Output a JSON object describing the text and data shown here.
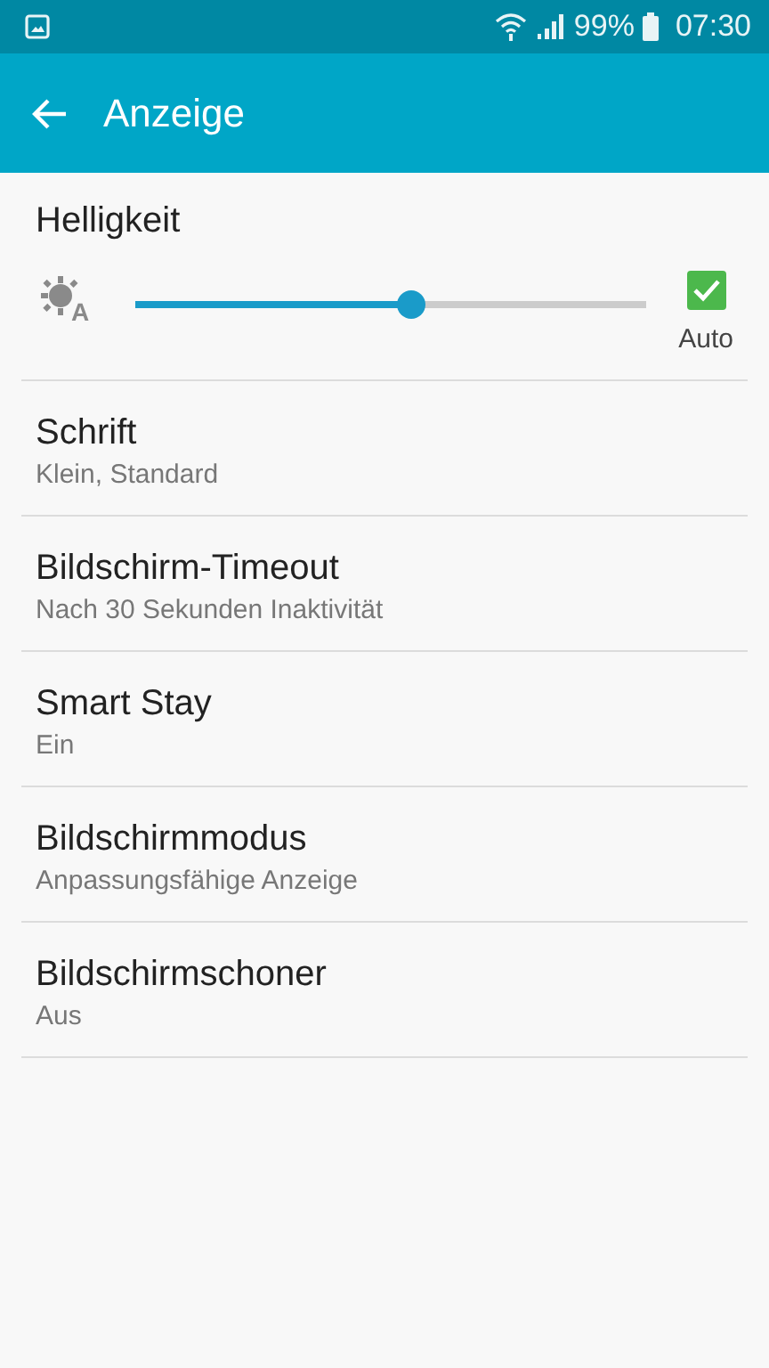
{
  "status_bar": {
    "battery": "99%",
    "time": "07:30"
  },
  "app_bar": {
    "title": "Anzeige"
  },
  "brightness": {
    "title": "Helligkeit",
    "icon_letter": "A",
    "level": 0.54,
    "auto": {
      "label": "Auto",
      "checked": true
    }
  },
  "settings": [
    {
      "title": "Schrift",
      "summary": "Klein, Standard"
    },
    {
      "title": "Bildschirm-Timeout",
      "summary": "Nach 30 Sekunden Inaktivität"
    },
    {
      "title": "Smart Stay",
      "summary": "Ein"
    },
    {
      "title": "Bildschirmmodus",
      "summary": "Anpassungsfähige Anzeige"
    },
    {
      "title": "Bildschirmschoner",
      "summary": "Aus"
    }
  ]
}
